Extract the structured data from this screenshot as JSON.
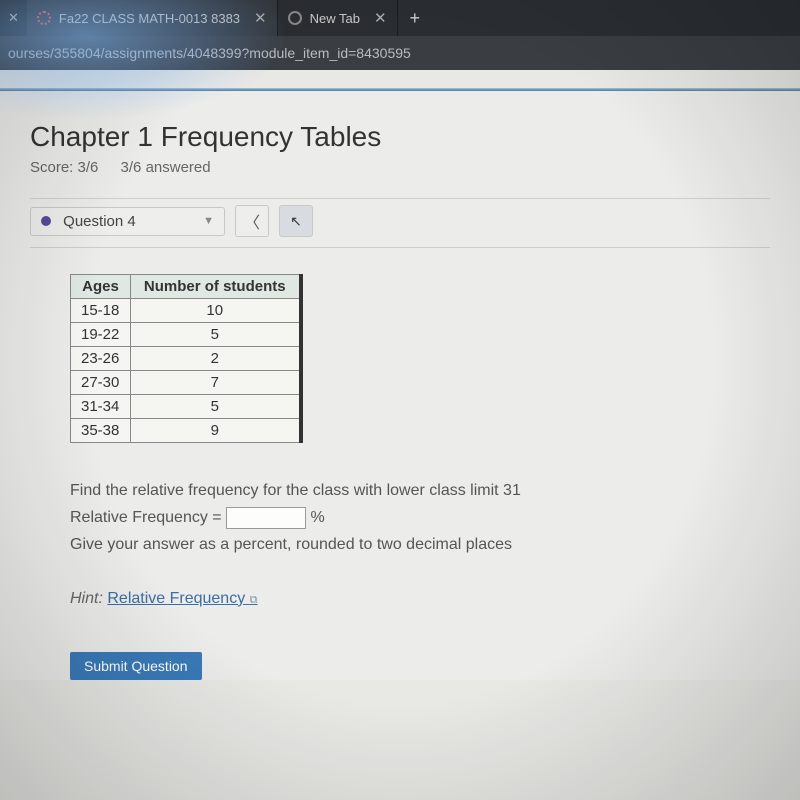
{
  "browser": {
    "tab1": {
      "title": "Fa22 CLASS MATH-0013 8383"
    },
    "tab2": {
      "title": "New Tab"
    },
    "url": "ourses/355804/assignments/4048399?module_item_id=8430595"
  },
  "header": {
    "title": "Chapter 1 Frequency Tables",
    "score_label": "Score: 3/6",
    "answered_label": "3/6 answered"
  },
  "question_select": {
    "label": "Question 4"
  },
  "table": {
    "col1_header": "Ages",
    "col2_header": "Number of students",
    "rows": [
      {
        "age": "15-18",
        "count": "10"
      },
      {
        "age": "19-22",
        "count": "5"
      },
      {
        "age": "23-26",
        "count": "2"
      },
      {
        "age": "27-30",
        "count": "7"
      },
      {
        "age": "31-34",
        "count": "5"
      },
      {
        "age": "35-38",
        "count": "9"
      }
    ]
  },
  "prompt": {
    "line1": "Find the relative frequency for the class with lower class limit 31",
    "line2_prefix": "Relative Frequency = ",
    "line2_suffix": " %",
    "line3": "Give your answer as a percent, rounded to two decimal places",
    "hint_label": "Hint:",
    "hint_link": "Relative Frequency"
  },
  "submit": {
    "label": "Submit Question"
  }
}
